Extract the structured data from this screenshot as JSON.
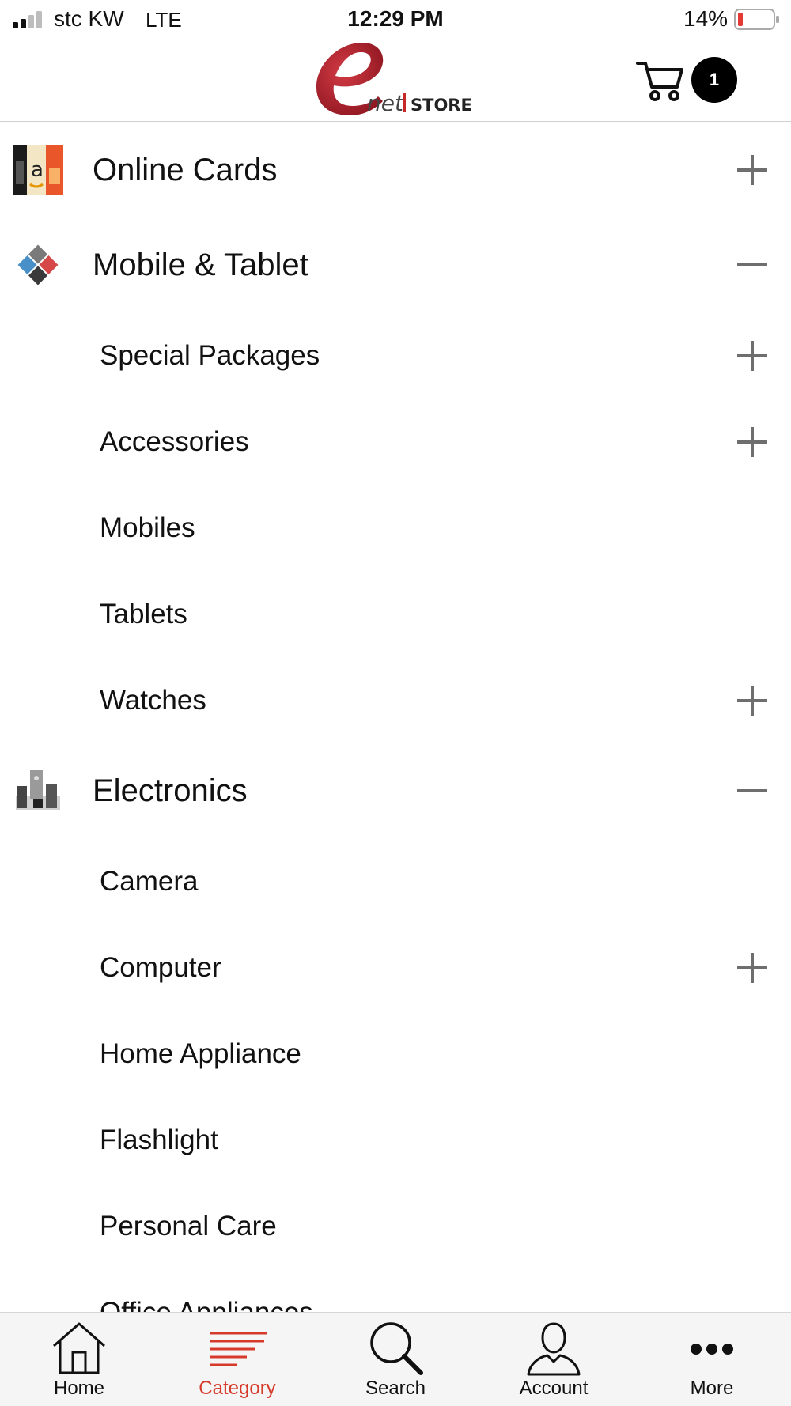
{
  "status_bar": {
    "carrier": "stc KW",
    "network": "LTE",
    "time": "12:29 PM",
    "battery": "14%"
  },
  "header": {
    "brand_small": "net",
    "brand_store": "STORE",
    "cart_count": "1"
  },
  "categories": [
    {
      "label": "Online Cards",
      "level": "top",
      "toggle": "plus",
      "icon": "gift-cards-thumbnail"
    },
    {
      "label": "Mobile & Tablet",
      "level": "top",
      "toggle": "minus",
      "icon": "mobile-tablet-thumbnail"
    },
    {
      "label": "Special Packages",
      "level": "sub",
      "toggle": "plus"
    },
    {
      "label": "Accessories",
      "level": "sub",
      "toggle": "plus"
    },
    {
      "label": "Mobiles",
      "level": "sub",
      "toggle": "none"
    },
    {
      "label": "Tablets",
      "level": "sub",
      "toggle": "none"
    },
    {
      "label": "Watches",
      "level": "sub",
      "toggle": "plus"
    },
    {
      "label": "Electronics",
      "level": "top",
      "toggle": "minus",
      "icon": "electronics-thumbnail"
    },
    {
      "label": "Camera",
      "level": "sub",
      "toggle": "none"
    },
    {
      "label": "Computer",
      "level": "sub",
      "toggle": "plus"
    },
    {
      "label": "Home Appliance",
      "level": "sub",
      "toggle": "none"
    },
    {
      "label": "Flashlight",
      "level": "sub",
      "toggle": "none"
    },
    {
      "label": "Personal Care",
      "level": "sub",
      "toggle": "none"
    },
    {
      "label": "Office Appliances",
      "level": "sub",
      "toggle": "none"
    }
  ],
  "tabs": [
    {
      "label": "Home",
      "icon": "home-icon",
      "active": false
    },
    {
      "label": "Category",
      "icon": "category-icon",
      "active": true
    },
    {
      "label": "Search",
      "icon": "search-icon",
      "active": false
    },
    {
      "label": "Account",
      "icon": "account-icon",
      "active": false
    },
    {
      "label": "More",
      "icon": "more-icon",
      "active": false
    }
  ],
  "colors": {
    "accent": "#d63a2a",
    "logo_red": "#b8202c",
    "toggle_gray": "#6e6e6e",
    "tabbar_bg": "#f5f5f5"
  }
}
